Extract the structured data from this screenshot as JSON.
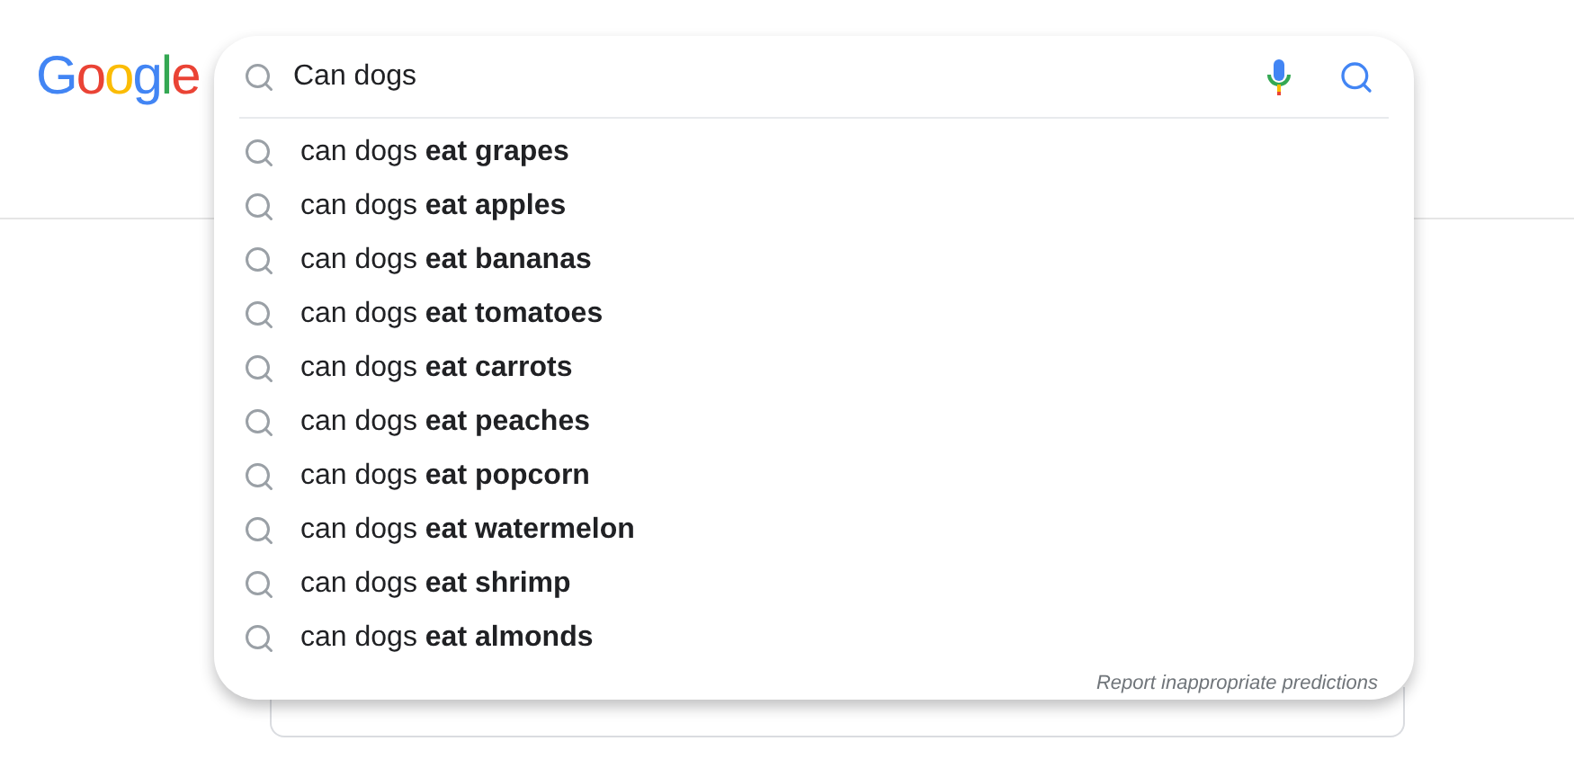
{
  "logo": {
    "letters": [
      {
        "char": "G",
        "color": "#4285f4"
      },
      {
        "char": "o",
        "color": "#ea4335"
      },
      {
        "char": "o",
        "color": "#fbbc05"
      },
      {
        "char": "g",
        "color": "#4285f4"
      },
      {
        "char": "l",
        "color": "#34a853"
      },
      {
        "char": "e",
        "color": "#ea4335"
      }
    ]
  },
  "search": {
    "value": "Can dogs"
  },
  "suggestions": [
    {
      "text": "can dogs **eat grapes**"
    },
    {
      "text": "can dogs **eat apples**"
    },
    {
      "text": "can dogs **eat bananas**"
    },
    {
      "text": "can dogs **eat tomatoes**"
    },
    {
      "text": "can dogs **eat carrots**"
    },
    {
      "text": "can dogs **eat peaches**"
    },
    {
      "text": "can dogs **eat popcorn**"
    },
    {
      "text": "can dogs **eat watermelon**"
    },
    {
      "text": "can dogs **eat shrimp**"
    },
    {
      "text": "can dogs **eat almonds**"
    }
  ],
  "report_link": "Report inappropriate predictions"
}
